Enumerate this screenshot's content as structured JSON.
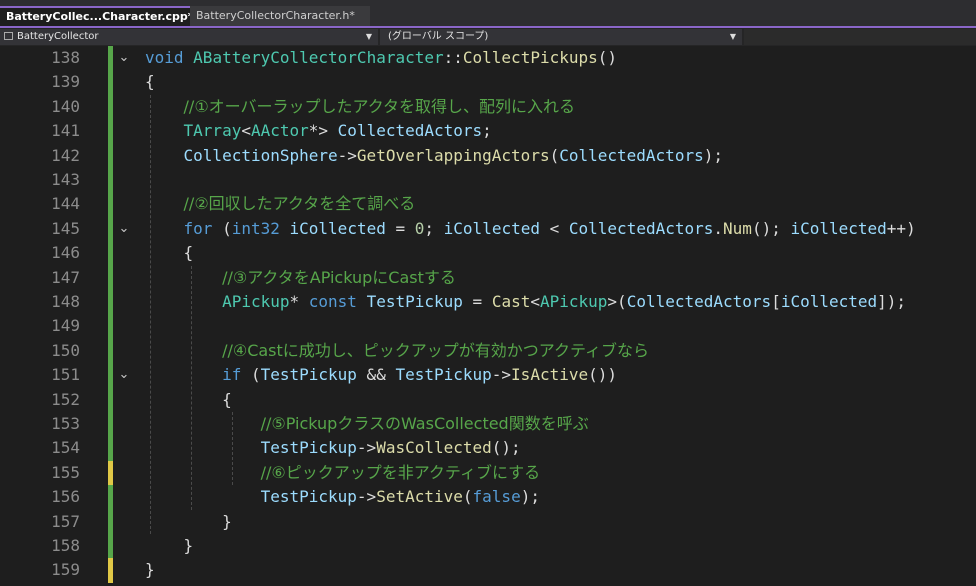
{
  "tabs": [
    {
      "label": "BatteryCollec...Character.cpp*",
      "pin": "⊸",
      "close": "✕"
    },
    {
      "label": "BatteryCollectorCharacter.h*"
    }
  ],
  "navbar": {
    "project": "BatteryCollector",
    "scope": "(グローバル スコープ)"
  },
  "lines": [
    {
      "n": "138",
      "marker": "green",
      "fold": true,
      "tokens": [
        {
          "t": "void",
          "c": "kw"
        },
        {
          "t": " "
        },
        {
          "t": "ABatteryCollectorCharacter",
          "c": "ty"
        },
        {
          "t": "::"
        },
        {
          "t": "CollectPickups",
          "c": "fn"
        },
        {
          "t": "()"
        }
      ]
    },
    {
      "n": "139",
      "marker": "green",
      "tokens": [
        {
          "t": "{"
        }
      ]
    },
    {
      "n": "140",
      "marker": "green",
      "tokens": [
        {
          "t": "    "
        },
        {
          "t": "//①オーバーラップしたアクタを取得し、配列に入れる",
          "c": "cm jp"
        }
      ]
    },
    {
      "n": "141",
      "marker": "green",
      "tokens": [
        {
          "t": "    "
        },
        {
          "t": "TArray",
          "c": "ty"
        },
        {
          "t": "<"
        },
        {
          "t": "AActor",
          "c": "ty"
        },
        {
          "t": "*> "
        },
        {
          "t": "CollectedActors",
          "c": "var"
        },
        {
          "t": ";"
        }
      ]
    },
    {
      "n": "142",
      "marker": "green",
      "tokens": [
        {
          "t": "    "
        },
        {
          "t": "CollectionSphere",
          "c": "var"
        },
        {
          "t": "->"
        },
        {
          "t": "GetOverlappingActors",
          "c": "fn"
        },
        {
          "t": "("
        },
        {
          "t": "CollectedActors",
          "c": "var"
        },
        {
          "t": ");"
        }
      ]
    },
    {
      "n": "143",
      "marker": "green",
      "tokens": []
    },
    {
      "n": "144",
      "marker": "green",
      "tokens": [
        {
          "t": "    "
        },
        {
          "t": "//②回収したアクタを全て調べる",
          "c": "cm jp"
        }
      ]
    },
    {
      "n": "145",
      "marker": "green",
      "fold": true,
      "tokens": [
        {
          "t": "    "
        },
        {
          "t": "for",
          "c": "kw"
        },
        {
          "t": " ("
        },
        {
          "t": "int32",
          "c": "kw"
        },
        {
          "t": " "
        },
        {
          "t": "iCollected",
          "c": "var"
        },
        {
          "t": " = "
        },
        {
          "t": "0",
          "c": "num-lit"
        },
        {
          "t": "; "
        },
        {
          "t": "iCollected",
          "c": "var"
        },
        {
          "t": " < "
        },
        {
          "t": "CollectedActors",
          "c": "var"
        },
        {
          "t": "."
        },
        {
          "t": "Num",
          "c": "fn"
        },
        {
          "t": "(); "
        },
        {
          "t": "iCollected",
          "c": "var"
        },
        {
          "t": "++)"
        }
      ]
    },
    {
      "n": "146",
      "marker": "green",
      "tokens": [
        {
          "t": "    {"
        }
      ]
    },
    {
      "n": "147",
      "marker": "green",
      "tokens": [
        {
          "t": "        "
        },
        {
          "t": "//③アクタをAPickupにCastする",
          "c": "cm jp"
        }
      ]
    },
    {
      "n": "148",
      "marker": "green",
      "tokens": [
        {
          "t": "        "
        },
        {
          "t": "APickup",
          "c": "ty"
        },
        {
          "t": "* "
        },
        {
          "t": "const",
          "c": "kw"
        },
        {
          "t": " "
        },
        {
          "t": "TestPickup",
          "c": "var"
        },
        {
          "t": " = "
        },
        {
          "t": "Cast",
          "c": "fn"
        },
        {
          "t": "<"
        },
        {
          "t": "APickup",
          "c": "ty"
        },
        {
          "t": ">("
        },
        {
          "t": "CollectedActors",
          "c": "var"
        },
        {
          "t": "["
        },
        {
          "t": "iCollected",
          "c": "var"
        },
        {
          "t": "]);"
        }
      ]
    },
    {
      "n": "149",
      "marker": "green",
      "tokens": []
    },
    {
      "n": "150",
      "marker": "green",
      "tokens": [
        {
          "t": "        "
        },
        {
          "t": "//④Castに成功し、ピックアップが有効かつアクティブなら",
          "c": "cm jp"
        }
      ]
    },
    {
      "n": "151",
      "marker": "green",
      "fold": true,
      "tokens": [
        {
          "t": "        "
        },
        {
          "t": "if",
          "c": "kw"
        },
        {
          "t": " ("
        },
        {
          "t": "TestPickup",
          "c": "var"
        },
        {
          "t": " && "
        },
        {
          "t": "TestPickup",
          "c": "var"
        },
        {
          "t": "->"
        },
        {
          "t": "IsActive",
          "c": "fn"
        },
        {
          "t": "())"
        }
      ]
    },
    {
      "n": "152",
      "marker": "green",
      "tokens": [
        {
          "t": "        {"
        }
      ]
    },
    {
      "n": "153",
      "marker": "green",
      "tokens": [
        {
          "t": "            "
        },
        {
          "t": "//⑤PickupクラスのWasCollected関数を呼ぶ",
          "c": "cm jp"
        }
      ]
    },
    {
      "n": "154",
      "marker": "green",
      "tokens": [
        {
          "t": "            "
        },
        {
          "t": "TestPickup",
          "c": "var"
        },
        {
          "t": "->"
        },
        {
          "t": "WasCollected",
          "c": "fn"
        },
        {
          "t": "();"
        }
      ]
    },
    {
      "n": "155",
      "marker": "yellow",
      "tokens": [
        {
          "t": "            "
        },
        {
          "t": "//⑥ピックアップを非アクティブにする",
          "c": "cm jp"
        }
      ]
    },
    {
      "n": "156",
      "marker": "green",
      "tokens": [
        {
          "t": "            "
        },
        {
          "t": "TestPickup",
          "c": "var"
        },
        {
          "t": "->"
        },
        {
          "t": "SetActive",
          "c": "fn"
        },
        {
          "t": "("
        },
        {
          "t": "false",
          "c": "kw"
        },
        {
          "t": ");"
        }
      ]
    },
    {
      "n": "157",
      "marker": "green",
      "tokens": [
        {
          "t": "        }"
        }
      ]
    },
    {
      "n": "158",
      "marker": "green",
      "tokens": [
        {
          "t": "    }"
        }
      ]
    },
    {
      "n": "159",
      "marker": "yellow",
      "tokens": [
        {
          "t": "}"
        }
      ]
    }
  ]
}
